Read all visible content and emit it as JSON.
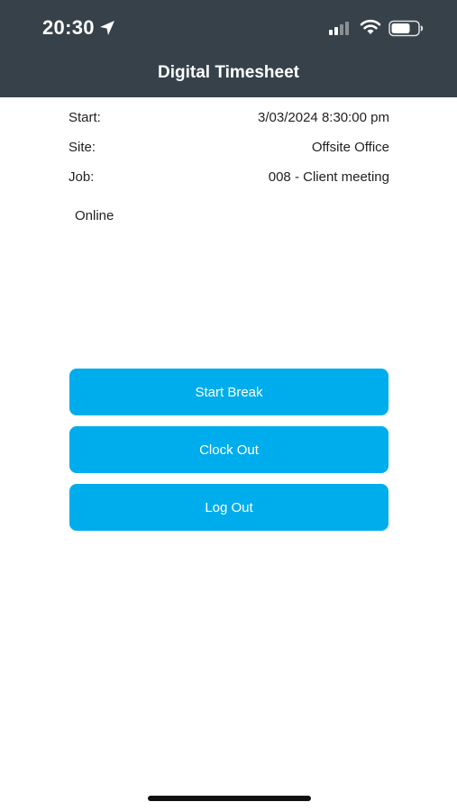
{
  "status_bar": {
    "time": "20:30",
    "icons": [
      "location-arrow-icon",
      "cellular-signal-icon",
      "wifi-icon",
      "battery-icon"
    ]
  },
  "header": {
    "title": "Digital Timesheet",
    "background_color": "#36414a"
  },
  "details": {
    "start_label": "Start:",
    "start_value": "3/03/2024 8:30:00 pm",
    "site_label": "Site:",
    "site_value": "Offsite Office",
    "job_label": "Job:",
    "job_value": "008 - Client meeting"
  },
  "connection_status": "Online",
  "actions": {
    "start_break": "Start Break",
    "clock_out": "Clock Out",
    "log_out": "Log Out",
    "button_color": "#00adec"
  }
}
